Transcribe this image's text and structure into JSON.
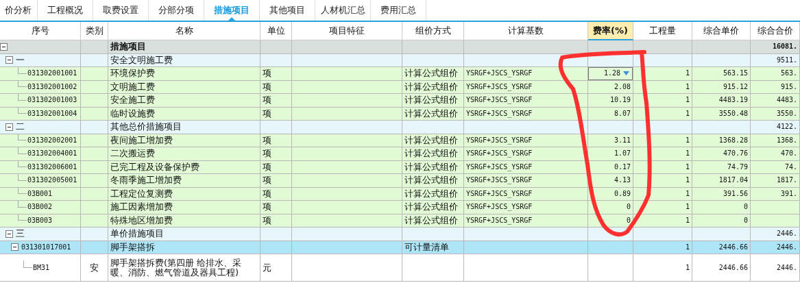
{
  "tabs": [
    {
      "label": "价分析",
      "selected": false
    },
    {
      "label": "工程概况",
      "selected": false
    },
    {
      "label": "取费设置",
      "selected": false
    },
    {
      "label": "分部分项",
      "selected": false
    },
    {
      "label": "措施项目",
      "selected": true
    },
    {
      "label": "其他项目",
      "selected": false
    },
    {
      "label": "人材机汇总",
      "selected": false
    },
    {
      "label": "费用汇总",
      "selected": false
    }
  ],
  "table": {
    "columns": [
      {
        "label": "序号",
        "selected": false
      },
      {
        "label": "类别",
        "selected": false
      },
      {
        "label": "名称",
        "selected": false
      },
      {
        "label": "单位",
        "selected": false
      },
      {
        "label": "项目特征",
        "selected": false
      },
      {
        "label": "组价方式",
        "selected": false
      },
      {
        "label": "计算基数",
        "selected": false
      },
      {
        "label": "费率(%)",
        "selected": true
      },
      {
        "label": "工程量",
        "selected": false
      },
      {
        "label": "综合单价",
        "selected": false
      },
      {
        "label": "综合合价",
        "selected": false
      }
    ],
    "rows": [
      {
        "kind": "root",
        "name": "措施项目",
        "total": "16081.",
        "expanded": true,
        "selected": false,
        "editing": false,
        "children": [
          {
            "kind": "group",
            "code": "一",
            "name": "安全文明施工费",
            "total": "9511.",
            "expanded": true,
            "selected": false,
            "editing": false,
            "children": [
              {
                "kind": "item",
                "code": "031302001001",
                "name": "环境保护费",
                "unit": "项",
                "method": "计算公式组价",
                "base": "YSRGF+JSCS_YSRGF",
                "rate": "1.28",
                "quantity": "1",
                "price": "563.15",
                "total": "563.",
                "selected": false,
                "editing": true
              },
              {
                "kind": "item",
                "code": "031302001002",
                "name": "文明施工费",
                "unit": "项",
                "method": "计算公式组价",
                "base": "YSRGF+JSCS_YSRGF",
                "rate": "2.08",
                "quantity": "1",
                "price": "915.12",
                "total": "915.",
                "selected": false,
                "editing": false
              },
              {
                "kind": "item",
                "code": "031302001003",
                "name": "安全施工费",
                "unit": "项",
                "method": "计算公式组价",
                "base": "YSRGF+JSCS_YSRGF",
                "rate": "10.19",
                "quantity": "1",
                "price": "4483.19",
                "total": "4483.",
                "selected": false,
                "editing": false
              },
              {
                "kind": "item",
                "code": "031302001004",
                "name": "临时设施费",
                "unit": "项",
                "method": "计算公式组价",
                "base": "YSRGF+JSCS_YSRGF",
                "rate": "8.07",
                "quantity": "1",
                "price": "3550.48",
                "total": "3550.",
                "selected": false,
                "editing": false
              }
            ]
          },
          {
            "kind": "group",
            "code": "二",
            "name": "其他总价措施项目",
            "total": "4122.",
            "expanded": true,
            "selected": false,
            "editing": false,
            "children": [
              {
                "kind": "item",
                "code": "031302002001",
                "name": "夜间施工增加费",
                "unit": "项",
                "method": "计算公式组价",
                "base": "YSRGF+JSCS_YSRGF",
                "rate": "3.11",
                "quantity": "1",
                "price": "1368.28",
                "total": "1368.",
                "selected": false,
                "editing": false
              },
              {
                "kind": "item",
                "code": "031302004001",
                "name": "二次搬运费",
                "unit": "项",
                "method": "计算公式组价",
                "base": "YSRGF+JSCS_YSRGF",
                "rate": "1.07",
                "quantity": "1",
                "price": "470.76",
                "total": "470.",
                "selected": false,
                "editing": false
              },
              {
                "kind": "item",
                "code": "031302006001",
                "name": "已完工程及设备保护费",
                "unit": "项",
                "method": "计算公式组价",
                "base": "YSRGF+JSCS_YSRGF",
                "rate": "0.17",
                "quantity": "1",
                "price": "74.79",
                "total": "74.",
                "selected": false,
                "editing": false
              },
              {
                "kind": "item",
                "code": "031302005001",
                "name": "冬雨季施工增加费",
                "unit": "项",
                "method": "计算公式组价",
                "base": "YSRGF+JSCS_YSRGF",
                "rate": "4.13",
                "quantity": "1",
                "price": "1817.04",
                "total": "1817.",
                "selected": false,
                "editing": false
              },
              {
                "kind": "item",
                "code": "03B001",
                "name": "工程定位复测费",
                "unit": "项",
                "method": "计算公式组价",
                "base": "YSRGF+JSCS_YSRGF",
                "rate": "0.89",
                "quantity": "1",
                "price": "391.56",
                "total": "391.",
                "selected": false,
                "editing": false
              },
              {
                "kind": "item",
                "code": "03B002",
                "name": "施工因素增加费",
                "unit": "项",
                "method": "计算公式组价",
                "base": "YSRGF+JSCS_YSRGF",
                "rate": "0",
                "quantity": "1",
                "price": "0",
                "selected": false,
                "editing": false
              },
              {
                "kind": "item",
                "code": "03B003",
                "name": "特殊地区增加费",
                "unit": "项",
                "method": "计算公式组价",
                "base": "YSRGF+JSCS_YSRGF",
                "rate": "0",
                "quantity": "1",
                "price": "0",
                "selected": false,
                "editing": false
              }
            ]
          },
          {
            "kind": "group",
            "code": "三",
            "name": "单价措施项目",
            "total": "2446.",
            "expanded": true,
            "selected": false,
            "editing": false,
            "children": [
              {
                "kind": "item",
                "code": "031301017001",
                "name": "脚手架搭拆",
                "method": "可计量清单",
                "quantity": "1",
                "price": "2446.66",
                "total": "2446.",
                "expanded": true,
                "selected": true,
                "editing": false,
                "children": [
                  {
                    "kind": "sub",
                    "code": "BM31",
                    "category": "安",
                    "name": "脚手架搭拆费(第四册 给排水、采暖、消防、燃气管道及器具工程)",
                    "unit": "元",
                    "quantity": "1",
                    "price": "2446.66",
                    "total": "2446.",
                    "selected": false,
                    "editing": false
                  }
                ]
              }
            ]
          }
        ]
      }
    ]
  },
  "annotations": [
    {
      "kind": "loop"
    }
  ]
}
